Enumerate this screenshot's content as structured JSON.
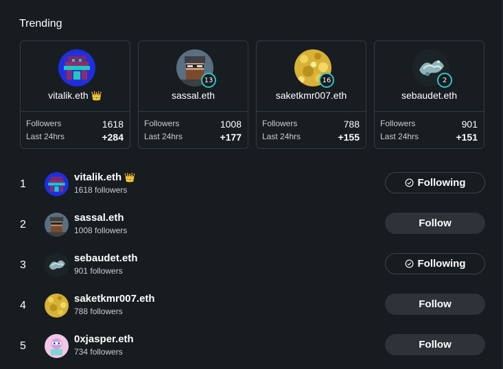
{
  "title": "Trending",
  "cards": [
    {
      "name": "vitalik.eth",
      "crown": "👑",
      "followers_label": "Followers",
      "followers": "1618",
      "last24_label": "Last 24hrs",
      "last24": "+284",
      "badge": ""
    },
    {
      "name": "sassal.eth",
      "crown": "",
      "followers_label": "Followers",
      "followers": "1008",
      "last24_label": "Last 24hrs",
      "last24": "+177",
      "badge": "13"
    },
    {
      "name": "saketkmr007.eth",
      "crown": "",
      "followers_label": "Followers",
      "followers": "788",
      "last24_label": "Last 24hrs",
      "last24": "+155",
      "badge": "16"
    },
    {
      "name": "sebaudet.eth",
      "crown": "",
      "followers_label": "Followers",
      "followers": "901",
      "last24_label": "Last 24hrs",
      "last24": "+151",
      "badge": "2"
    }
  ],
  "list": [
    {
      "rank": "1",
      "name": "vitalik.eth",
      "crown": "👑",
      "followers": "1618 followers",
      "button": "Following",
      "state": "following"
    },
    {
      "rank": "2",
      "name": "sassal.eth",
      "crown": "",
      "followers": "1008 followers",
      "button": "Follow",
      "state": "follow"
    },
    {
      "rank": "3",
      "name": "sebaudet.eth",
      "crown": "",
      "followers": "901 followers",
      "button": "Following",
      "state": "following"
    },
    {
      "rank": "4",
      "name": "saketkmr007.eth",
      "crown": "",
      "followers": "788 followers",
      "button": "Follow",
      "state": "follow"
    },
    {
      "rank": "5",
      "name": "0xjasper.eth",
      "crown": "",
      "followers": "734 followers",
      "button": "Follow",
      "state": "follow"
    }
  ],
  "icons": {
    "following": "check-circle-icon",
    "badge": "ring-badge-icon"
  },
  "colors": {
    "background": "#171c20",
    "card_border": "#333a41",
    "badge_ring": "#2cc6c6",
    "follow_button": "#2d3339"
  }
}
